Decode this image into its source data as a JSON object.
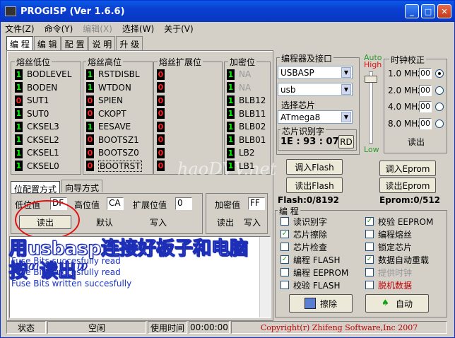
{
  "window": {
    "title": "PROGISP  (Ver 1.6.6)"
  },
  "menu": [
    "文件(Z)",
    "命令(Y)",
    "编辑(X)",
    "选择(W)",
    "关于(V)"
  ],
  "tabs": [
    "编 程",
    "编 辑",
    "配 置",
    "说 明",
    "升 级"
  ],
  "fuse_low": {
    "header": "熔丝低位",
    "items": [
      {
        "bit": "1",
        "name": "BODLEVEL"
      },
      {
        "bit": "1",
        "name": "BODEN"
      },
      {
        "bit": "0",
        "name": "SUT1"
      },
      {
        "bit": "1",
        "name": "SUT0"
      },
      {
        "bit": "1",
        "name": "CKSEL3"
      },
      {
        "bit": "1",
        "name": "CKSEL2"
      },
      {
        "bit": "1",
        "name": "CKSEL1"
      },
      {
        "bit": "1",
        "name": "CKSEL0"
      }
    ]
  },
  "fuse_high": {
    "header": "熔丝高位",
    "items": [
      {
        "bit": "1",
        "name": "RSTDISBL"
      },
      {
        "bit": "1",
        "name": "WTDON"
      },
      {
        "bit": "0",
        "name": "SPIEN"
      },
      {
        "bit": "0",
        "name": "CKOPT"
      },
      {
        "bit": "1",
        "name": "EESAVE"
      },
      {
        "bit": "0",
        "name": "BOOTSZ1"
      },
      {
        "bit": "0",
        "name": "BOOTSZ0"
      },
      {
        "bit": "0",
        "name": "BOOTRST"
      }
    ]
  },
  "fuse_ext": {
    "header": "熔丝扩展位",
    "items": [
      "0",
      "0",
      "0",
      "0",
      "0",
      "0",
      "0",
      "0"
    ]
  },
  "lock": {
    "header": "加密位",
    "items": [
      {
        "bit": "1",
        "name": "NA"
      },
      {
        "bit": "1",
        "name": "NA"
      },
      {
        "bit": "1",
        "name": "BLB12"
      },
      {
        "bit": "1",
        "name": "BLB11"
      },
      {
        "bit": "1",
        "name": "BLB02"
      },
      {
        "bit": "1",
        "name": "BLB01"
      },
      {
        "bit": "1",
        "name": "LB2"
      },
      {
        "bit": "1",
        "name": "LB1"
      }
    ]
  },
  "config_tabs": [
    "位配置方式",
    "向导方式"
  ],
  "values": {
    "low_label": "低位值",
    "low_val": "DF",
    "high_label": "高位值",
    "high_val": "CA",
    "ext_label": "扩展位值",
    "ext_val": "0",
    "lock_label": "加密值",
    "lock_val": "FF"
  },
  "buttons": {
    "read": "读出",
    "default": "默认",
    "write": "写入",
    "lock_read": "读出",
    "lock_write": "写入"
  },
  "log": [
    "Fuse Bits succesfully read",
    "Fuse Bits succesfully read",
    "Fuse Bits written succesfully"
  ],
  "overlay": {
    "line1": "用usbasp连接好板子和电脑",
    "line2": "按“读出”"
  },
  "programmer": {
    "header": "编程器及接口",
    "device": "USBASP",
    "port": "usb"
  },
  "chip": {
    "header": "选择芯片",
    "value": "ATmega8",
    "id_label": "芯片识别字",
    "id": "1E : 93 : 07",
    "rd": "RD"
  },
  "speed": {
    "auto": "Auto",
    "high": "High",
    "low": "Low"
  },
  "clock": {
    "header": "时钟校正",
    "items": [
      {
        "label": "1.0 MHz",
        "val": "00",
        "on": true
      },
      {
        "label": "2.0 MHz",
        "val": "00",
        "on": false
      },
      {
        "label": "4.0 MHz",
        "val": "00",
        "on": false
      },
      {
        "label": "8.0 MHz",
        "val": "00",
        "on": false
      }
    ],
    "read": "读出"
  },
  "flash_btns": {
    "load_flash": "调入Flash",
    "read_flash": "读出Flash",
    "load_eprom": "调入Eprom",
    "read_eprom": "读出Eprom"
  },
  "sizes": {
    "flash": "Flash:0/8192",
    "eprom": "Eprom:0/512"
  },
  "prog": {
    "header": "编 程",
    "left": [
      {
        "label": "读识别字",
        "on": false
      },
      {
        "label": "芯片擦除",
        "on": true
      },
      {
        "label": "芯片检查",
        "on": false
      },
      {
        "label": "编程 FLASH",
        "on": true
      },
      {
        "label": "编程 EEPROM",
        "on": false
      },
      {
        "label": "校验 FLASH",
        "on": false
      }
    ],
    "right": [
      {
        "label": "校验 EEPROM",
        "on": true
      },
      {
        "label": "编程熔丝",
        "on": false
      },
      {
        "label": "锁定芯片",
        "on": false
      },
      {
        "label": "数据自动重载",
        "on": true
      },
      {
        "label": "提供时钟",
        "on": false
      },
      {
        "label": "脱机数据",
        "on": false
      }
    ],
    "erase": "擦除",
    "auto": "自动"
  },
  "statusbar": {
    "state_label": "状态",
    "state": "空闲",
    "time_label": "使用时间",
    "time": "00:00:00",
    "copyright": "Copyright(r) Zhifeng Software,Inc 2007"
  },
  "watermark": "haoDVV.net",
  "colors": {
    "title": "#0a3fd0",
    "copyright": "#c00000",
    "log": "#1a33c9",
    "overlay_stroke": "#1d2fb7"
  }
}
